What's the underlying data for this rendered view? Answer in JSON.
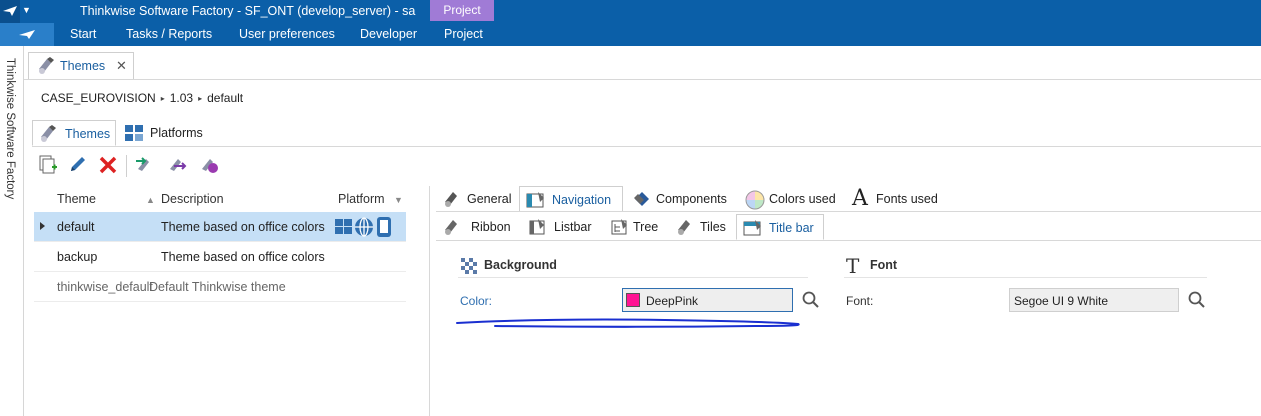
{
  "window": {
    "title": "Thinkwise Software Factory - SF_ONT (develop_server) - sa",
    "context_tab": "Project"
  },
  "menu": {
    "items": [
      "Start",
      "Tasks / Reports",
      "User preferences",
      "Developer",
      "Project"
    ]
  },
  "side_strip": {
    "label": "Thinkwise Software Factory"
  },
  "doc_tab": {
    "label": "Themes",
    "close": "✕"
  },
  "breadcrumb": {
    "items": [
      "CASE_EUROVISION",
      "1.03",
      "default"
    ],
    "separator": "▸"
  },
  "inner_tabs": [
    {
      "label": "Themes",
      "active": true
    },
    {
      "label": "Platforms",
      "active": false
    }
  ],
  "grid": {
    "columns": [
      "Theme",
      "Description",
      "Platform"
    ],
    "rows": [
      {
        "theme": "default",
        "description": "Theme based on office colors",
        "selected": true
      },
      {
        "theme": "backup",
        "description": "Theme based on office colors",
        "selected": false
      },
      {
        "theme": "thinkwise_default",
        "description": "Default Thinkwise theme",
        "selected": false
      }
    ]
  },
  "detail_tabs": {
    "main": [
      "General",
      "Navigation",
      "Components",
      "Colors used",
      "Fonts used"
    ],
    "main_active": "Navigation",
    "sub": [
      "Ribbon",
      "Listbar",
      "Tree",
      "Tiles",
      "Title bar"
    ],
    "sub_active": "Title bar"
  },
  "background_group": {
    "header": "Background",
    "color_label": "Color:",
    "color_value": "DeepPink",
    "color_hex": "#ff1493"
  },
  "font_group": {
    "header": "Font",
    "font_label": "Font:",
    "font_value": "Segoe UI 9 White"
  },
  "colors": {
    "title_bar": "#0b5fa8",
    "context_tab": "#a07bd6",
    "selected_row": "#c5dff6",
    "annotation_ink": "#1a2fd0"
  }
}
